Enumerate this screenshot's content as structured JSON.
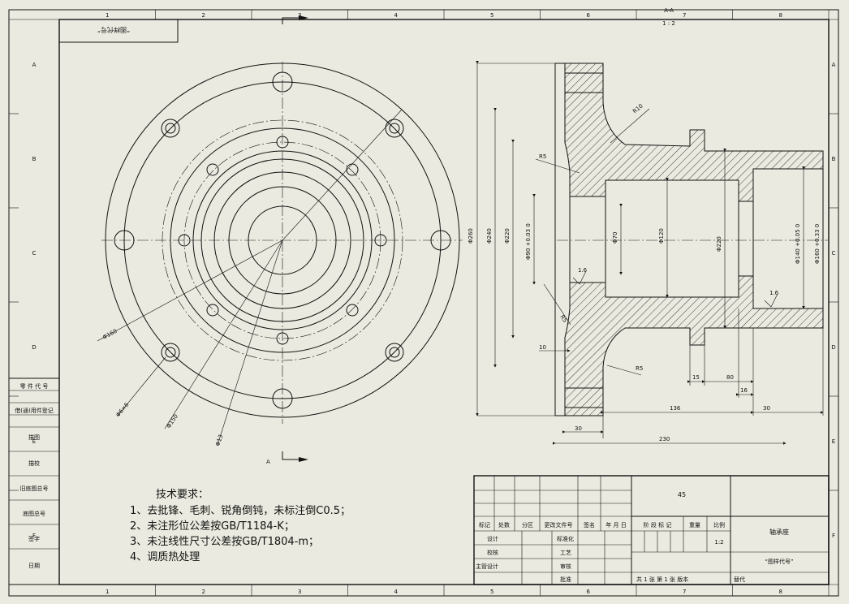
{
  "sheet": {
    "zone_cols": [
      "1",
      "2",
      "3",
      "4",
      "5",
      "6",
      "7",
      "8"
    ],
    "zone_rows": [
      "A",
      "B",
      "C",
      "D",
      "E",
      "F"
    ],
    "top_left_code": "“图样代号”",
    "section_mark_top": "A-A",
    "section_mark_scale": "1 : 2",
    "view_mark": "A"
  },
  "left_strip": [
    "零 件 代 号",
    "借(通)用件登记",
    "描图",
    "描校",
    "旧底图总号",
    "底图总号",
    "签字",
    "日期"
  ],
  "dimensions": {
    "front_view": [
      "Φ160",
      "Φ6×6",
      "Φ150",
      "Φ13"
    ],
    "section": [
      "R10",
      "R5",
      "Φ260",
      "Φ240",
      "Φ220",
      "Φ90 +0.03 0",
      "Φ70",
      "Φ120",
      "Φ220",
      "Φ140 +0.05 0",
      "Φ160 +0.33 0",
      "R5",
      "10",
      "R5",
      "1.6",
      "1.6",
      "15",
      "80",
      "16",
      "136",
      "30",
      "30",
      "230"
    ]
  },
  "tech_requirements": {
    "title": "技术要求：",
    "items": [
      "1、去批锋、毛刺、锐角倒钝，未标注倒C0.5；",
      "2、未注形位公差按GB/T1184-K；",
      "3、未注线性尺寸公差按GB/T1804-m；",
      "4、调质热处理"
    ]
  },
  "title_block": {
    "material_code": "45",
    "part_name": "轴承座",
    "drawing_code": "“图样代号”",
    "scale_value": "1:2",
    "header_row": [
      "标记",
      "处数",
      "分区",
      "更改文件号",
      "签名",
      "年 月 日"
    ],
    "roles_left": [
      "设计",
      "校核",
      "主管设计"
    ],
    "roles_mid": [
      "标准化",
      "工艺",
      "审核",
      "批准"
    ],
    "stage_labels": [
      "阶 段 标 记",
      "重量",
      "比例"
    ],
    "sheet_info": "共 1 张  第 1 张  版本",
    "replace_label": "替代"
  }
}
